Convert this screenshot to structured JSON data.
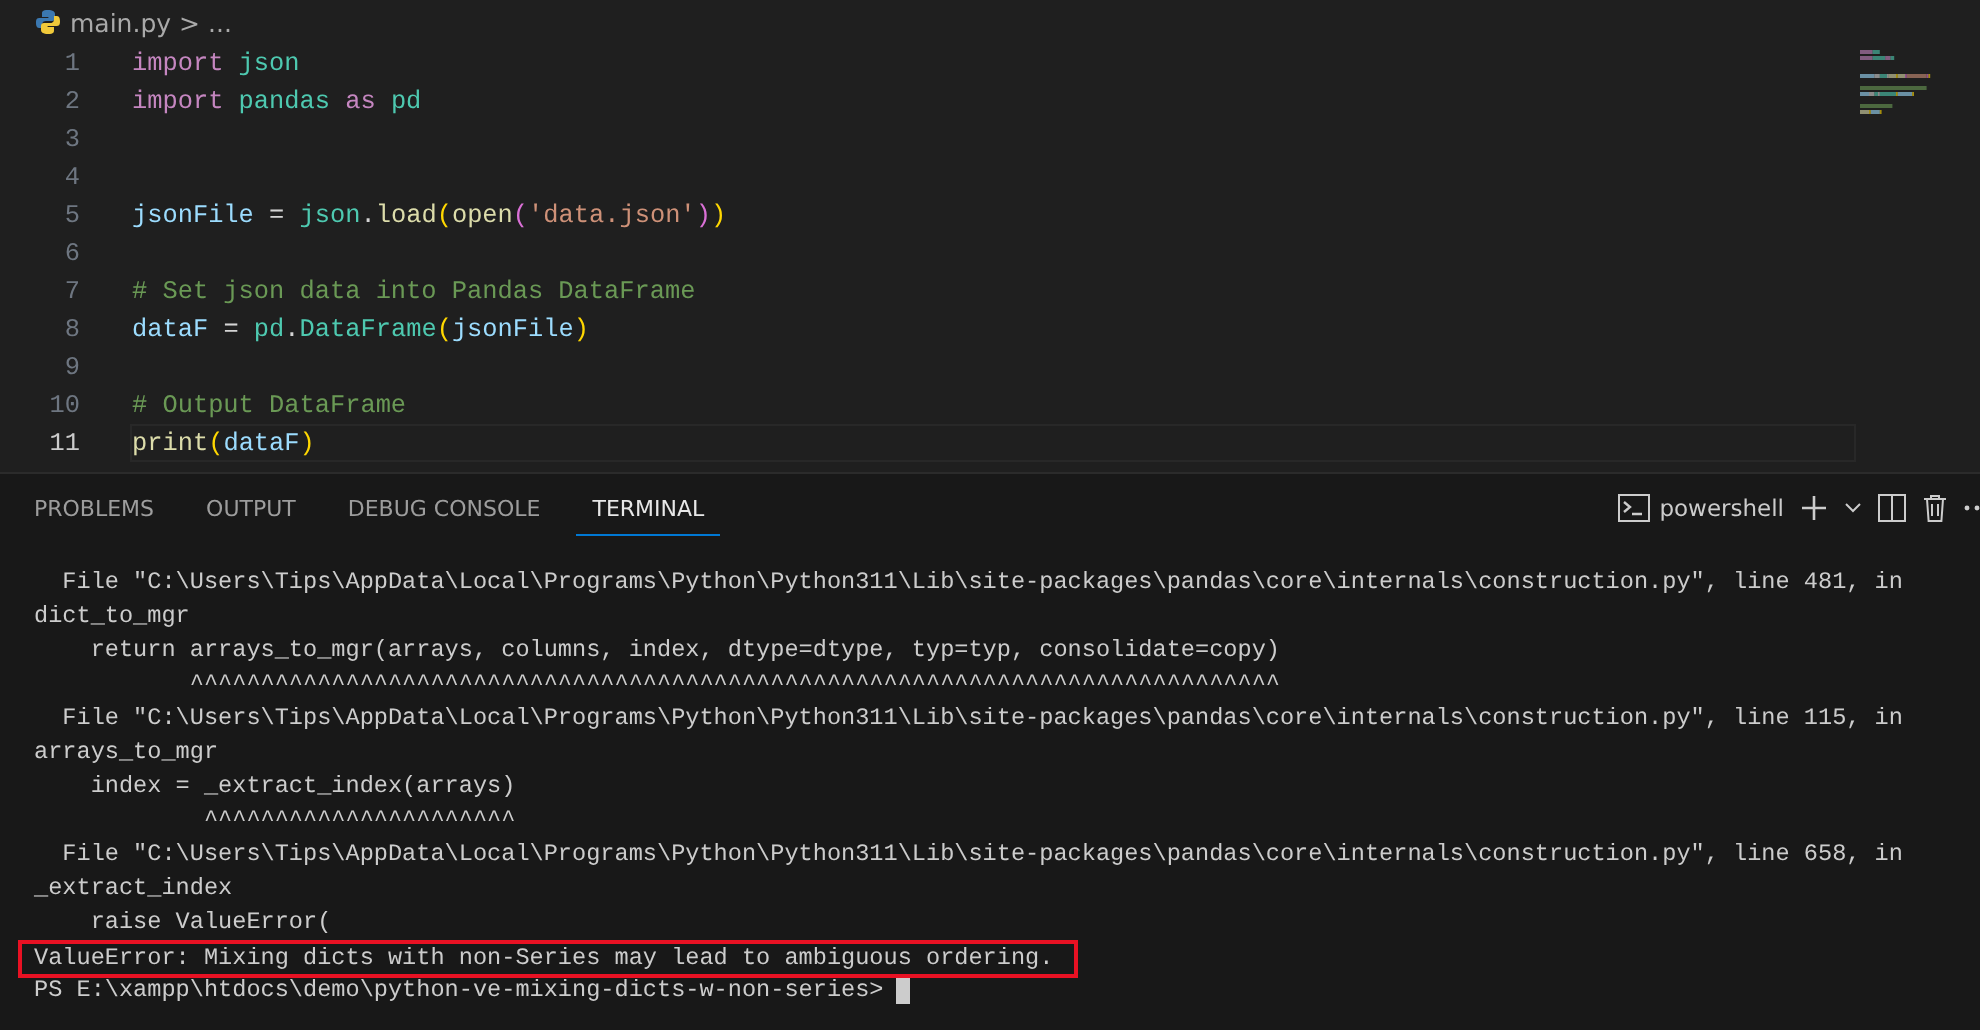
{
  "breadcrumb": {
    "file": "main.py",
    "separator": ">",
    "more": "..."
  },
  "editor": {
    "lines": [
      {
        "number": "1",
        "current": false,
        "tokens": [
          {
            "kind": "keyword",
            "text": "import "
          },
          {
            "kind": "module",
            "text": "json"
          }
        ]
      },
      {
        "number": "2",
        "current": false,
        "tokens": [
          {
            "kind": "keyword",
            "text": "import "
          },
          {
            "kind": "module",
            "text": "pandas "
          },
          {
            "kind": "keyword",
            "text": "as "
          },
          {
            "kind": "module",
            "text": "pd"
          }
        ]
      },
      {
        "number": "3",
        "current": false
      },
      {
        "number": "4",
        "current": false
      },
      {
        "number": "5",
        "current": false,
        "tokens": [
          {
            "kind": "variable",
            "text": "jsonFile"
          },
          {
            "kind": "plain",
            "text": " = "
          },
          {
            "kind": "module",
            "text": "json"
          },
          {
            "kind": "plain",
            "text": "."
          },
          {
            "kind": "function",
            "text": "load"
          },
          {
            "kind": "bracket1",
            "text": "("
          },
          {
            "kind": "function",
            "text": "open"
          },
          {
            "kind": "bracket2",
            "text": "("
          },
          {
            "kind": "string",
            "text": "'data.json'"
          },
          {
            "kind": "bracket2",
            "text": ")"
          },
          {
            "kind": "bracket1",
            "text": ")"
          }
        ]
      },
      {
        "number": "6",
        "current": false
      },
      {
        "number": "7",
        "current": false,
        "tokens": [
          {
            "kind": "comment",
            "text": "# Set json data into Pandas DataFrame"
          }
        ]
      },
      {
        "number": "8",
        "current": false,
        "tokens": [
          {
            "kind": "variable",
            "text": "dataF"
          },
          {
            "kind": "plain",
            "text": " = "
          },
          {
            "kind": "module",
            "text": "pd"
          },
          {
            "kind": "plain",
            "text": "."
          },
          {
            "kind": "module",
            "text": "DataFrame"
          },
          {
            "kind": "bracket1",
            "text": "("
          },
          {
            "kind": "variable",
            "text": "jsonFile"
          },
          {
            "kind": "bracket1",
            "text": ")"
          }
        ]
      },
      {
        "number": "9",
        "current": false
      },
      {
        "number": "10",
        "current": false,
        "tokens": [
          {
            "kind": "comment",
            "text": "# Output DataFrame"
          }
        ]
      },
      {
        "number": "11",
        "current": true,
        "tokens": [
          {
            "kind": "function",
            "text": "print"
          },
          {
            "kind": "bracket1",
            "text": "("
          },
          {
            "kind": "variable",
            "text": "dataF"
          },
          {
            "kind": "bracket1",
            "text": ")"
          }
        ]
      }
    ]
  },
  "panel": {
    "tabs": [
      {
        "label": "PROBLEMS",
        "selected": false
      },
      {
        "label": "OUTPUT",
        "selected": false
      },
      {
        "label": "DEBUG CONSOLE",
        "selected": false
      },
      {
        "label": "TERMINAL",
        "selected": true
      }
    ],
    "terminal_name": "powershell"
  },
  "terminal": {
    "lines": [
      {
        "kind": "text",
        "text": "  File \"C:\\Users\\Tips\\AppData\\Local\\Programs\\Python\\Python311\\Lib\\site-packages\\pandas\\core\\internals\\construction.py\", line 481, in"
      },
      {
        "kind": "text",
        "text": "dict_to_mgr"
      },
      {
        "kind": "text",
        "text": "    return arrays_to_mgr(arrays, columns, index, dtype=dtype, typ=typ, consolidate=copy)"
      },
      {
        "kind": "carets",
        "text": "           ^^^^^^^^^^^^^^^^^^^^^^^^^^^^^^^^^^^^^^^^^^^^^^^^^^^^^^^^^^^^^^^^^^^^^^^^^^^^^"
      },
      {
        "kind": "text",
        "text": "  File \"C:\\Users\\Tips\\AppData\\Local\\Programs\\Python\\Python311\\Lib\\site-packages\\pandas\\core\\internals\\construction.py\", line 115, in"
      },
      {
        "kind": "text",
        "text": "arrays_to_mgr"
      },
      {
        "kind": "text",
        "text": "    index = _extract_index(arrays)"
      },
      {
        "kind": "carets",
        "text": "            ^^^^^^^^^^^^^^^^^^^^^^"
      },
      {
        "kind": "text",
        "text": "  File \"C:\\Users\\Tips\\AppData\\Local\\Programs\\Python\\Python311\\Lib\\site-packages\\pandas\\core\\internals\\construction.py\", line 658, in"
      },
      {
        "kind": "text",
        "text": "_extract_index"
      },
      {
        "kind": "text",
        "text": "    raise ValueError("
      },
      {
        "kind": "error",
        "text": "ValueError: Mixing dicts with non-Series may lead to ambiguous ordering."
      },
      {
        "kind": "prompt",
        "text": "PS E:\\xampp\\htdocs\\demo\\python-ve-mixing-dicts-w-non-series>"
      }
    ]
  }
}
